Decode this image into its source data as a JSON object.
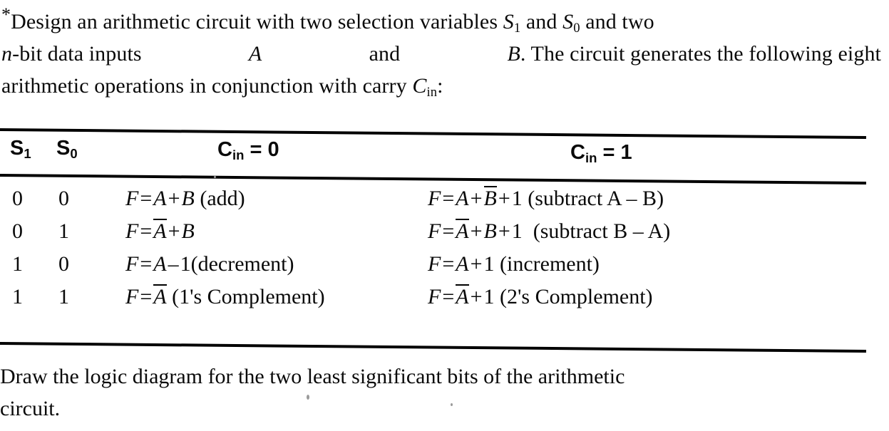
{
  "document": {
    "type": "textbook-exercise",
    "intro": {
      "marker": "*",
      "line1_a": "Design an arithmetic circuit with two selection variables",
      "line1_s1": "S",
      "line1_s1_sub": "1",
      "line1_and": "and",
      "line1_s0": "S",
      "line1_s0_sub": "0",
      "line1_end": "and two",
      "line2_n": "n",
      "line2_a": "-bit data inputs",
      "line2_A": "A",
      "line2_and": "and",
      "line2_B": "B",
      "line2_end": ". The circuit generates the following eight",
      "line3_a": "arithmetic operations in conjunction with carry",
      "line3_C": "C",
      "line3_C_sub": "in",
      "line3_end": ":",
      "full_text": "*Design an arithmetic circuit with two selection variables S1 and S0 and two n-bit data inputs A and B. The circuit generates the following eight arithmetic operations in conjunction with carry Cin:"
    },
    "table": {
      "headers": {
        "s1": "S",
        "s1_sub": "1",
        "s0": "S",
        "s0_sub": "0",
        "cin0_c": "C",
        "cin0_sub": "in",
        "cin0_eq": " = 0",
        "cin1_c": "C",
        "cin1_sub": "in",
        "cin1_eq": " = 1"
      },
      "header_labels": [
        "S1",
        "S0",
        "Cin = 0",
        "Cin = 1"
      ],
      "rows": [
        {
          "s1": "0",
          "s0": "0",
          "cin0_text": "F = A + B (add)",
          "cin1_text": "F = A + B̅ + 1 (subtract A – B)"
        },
        {
          "s1": "0",
          "s0": "1",
          "cin0_text": "F = A̅ + B",
          "cin1_text": "F = A̅ + B + 1  (subtract B – A)"
        },
        {
          "s1": "1",
          "s0": "0",
          "cin0_text": "F = A – 1 (decrement)",
          "cin1_text": "F = A + 1 (increment)"
        },
        {
          "s1": "1",
          "s0": "1",
          "cin0_text": "F = A̅ (1's Complement)",
          "cin1_text": "F = A̅ + 1 (2's Complement)"
        }
      ],
      "parts": {
        "F": "F",
        "eq": "=",
        "plus": "+",
        "minus": "–",
        "one": "1",
        "A": "A",
        "B": "B",
        "add": "(add)",
        "subtract_AB": "(subtract A – B)",
        "subtract_BA": "(subtract B – A)",
        "decrement": "(decrement)",
        "increment": "(increment)",
        "ones_complement": "(1's Complement)",
        "twos_complement": "(2's Complement)"
      }
    },
    "outro": {
      "line1": "Draw the logic diagram for the two least significant bits of the arithmetic",
      "line2": "circuit.",
      "full_text": "Draw the logic diagram for the two least significant bits of the arithmetic circuit."
    },
    "colors": {
      "ink": "#0a0a0a",
      "paper": "#ffffff",
      "rule": "#000000"
    }
  }
}
